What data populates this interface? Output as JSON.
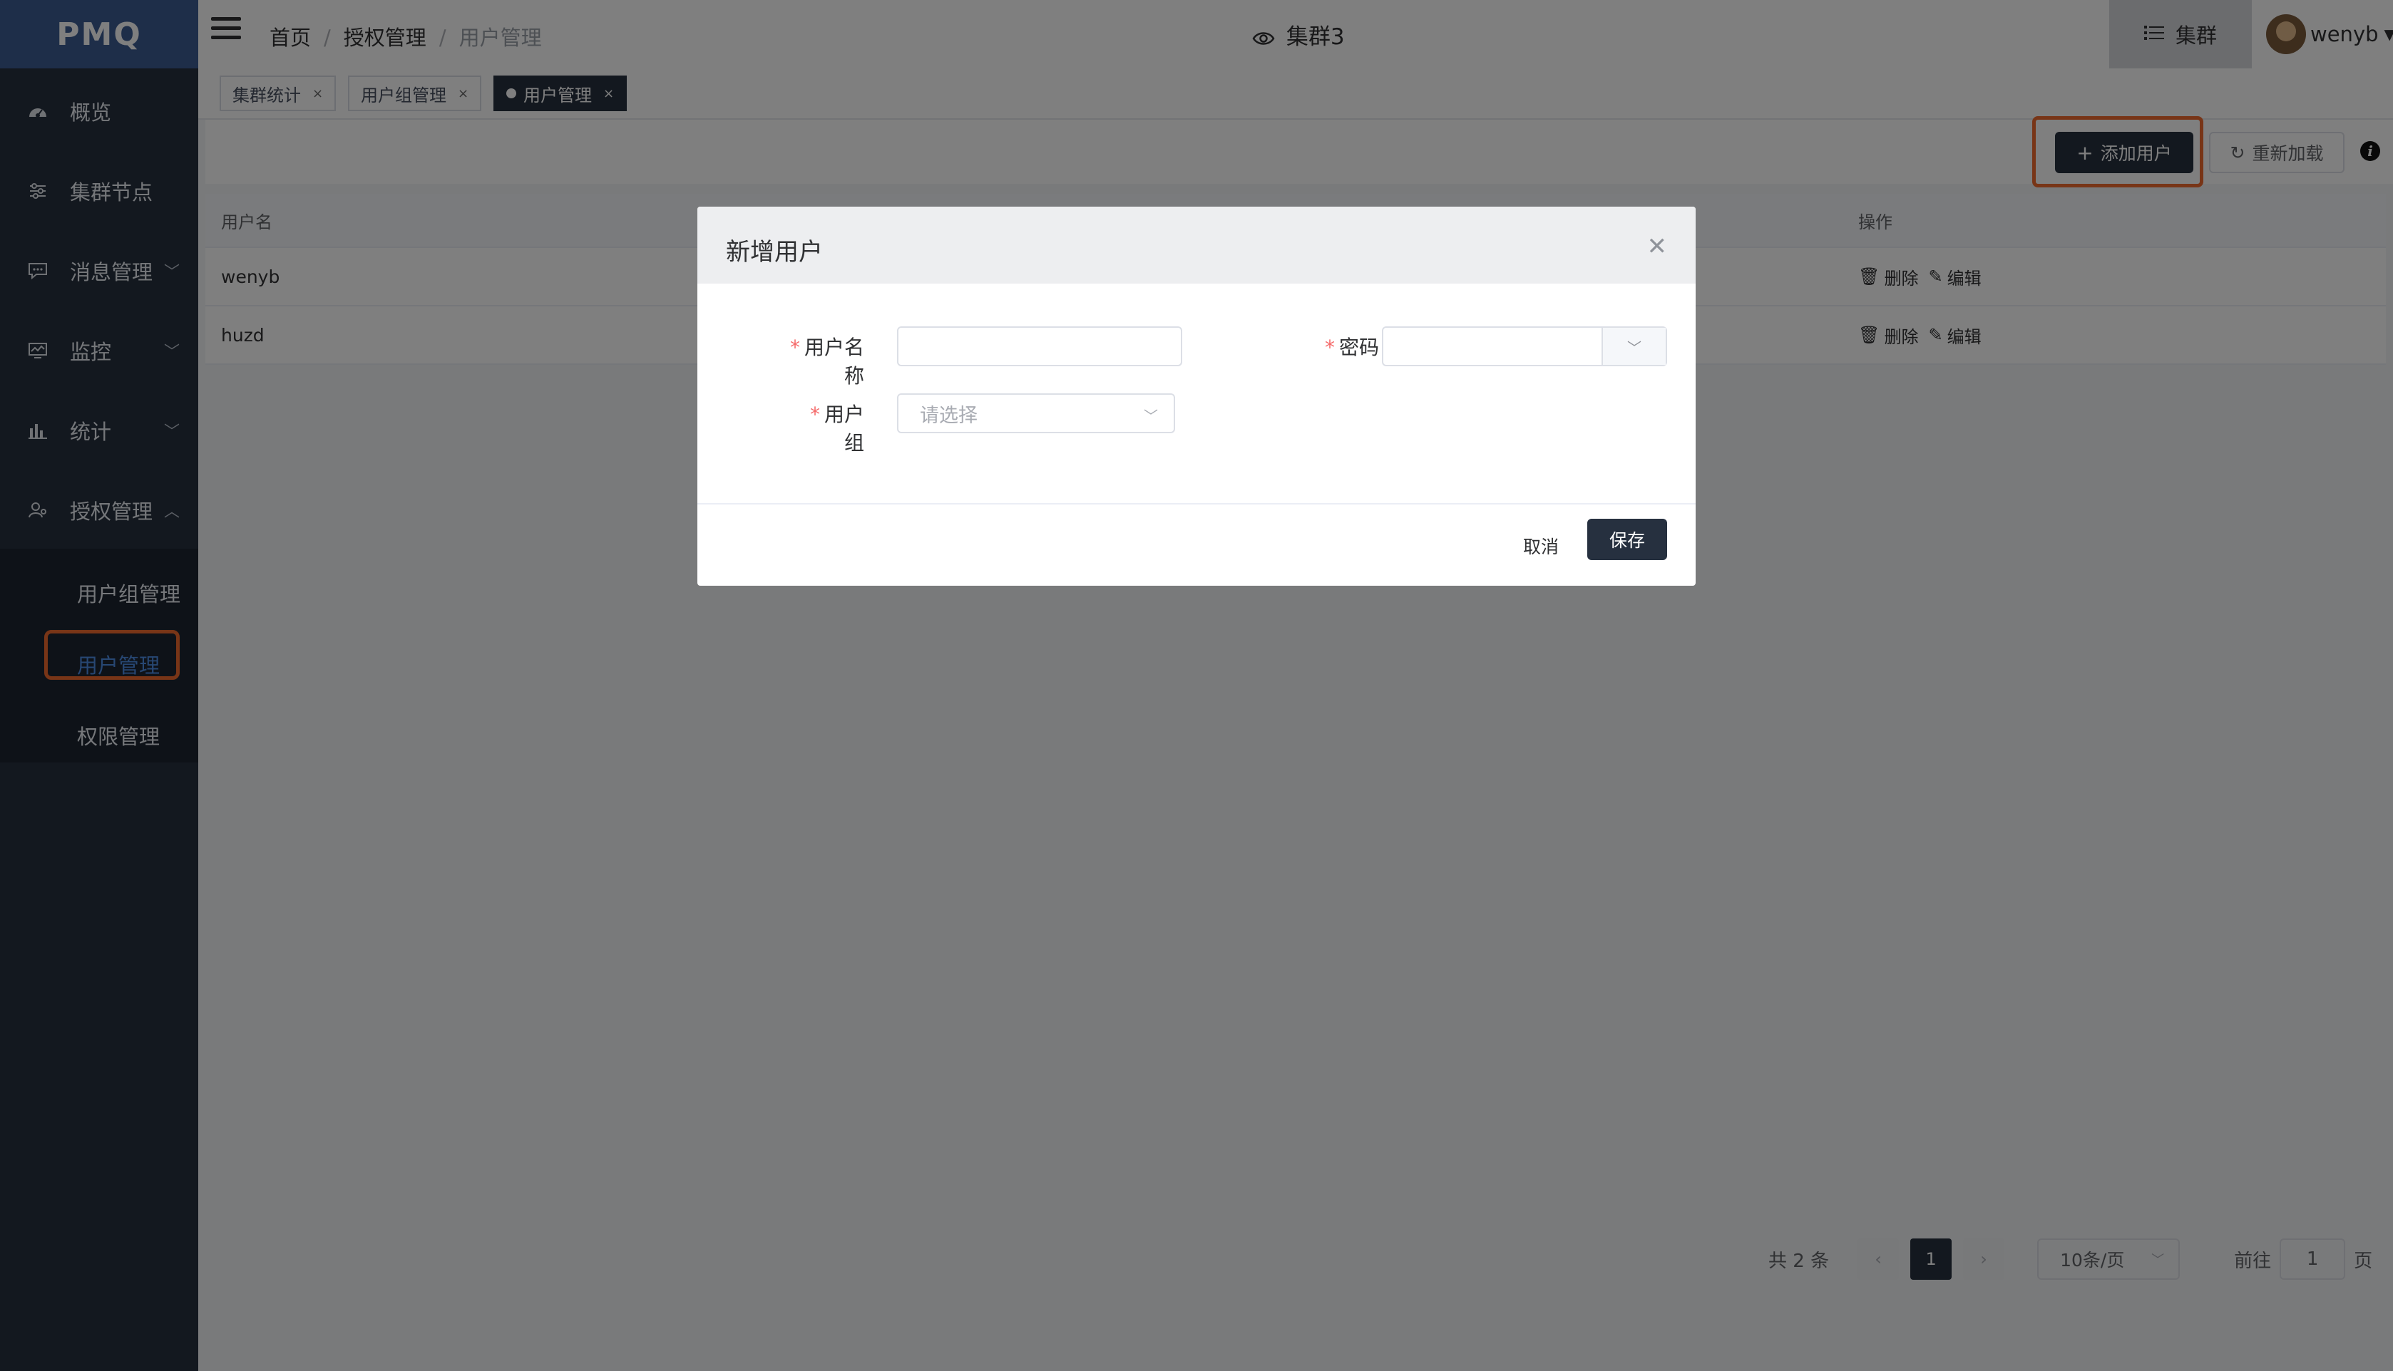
{
  "app": {
    "logo": "PMQ"
  },
  "sidebar": {
    "items": [
      {
        "label": "概览",
        "icon": "dashboard-icon"
      },
      {
        "label": "集群节点",
        "icon": "nodes-icon"
      },
      {
        "label": "消息管理",
        "icon": "message-icon"
      },
      {
        "label": "监控",
        "icon": "monitor-icon"
      },
      {
        "label": "统计",
        "icon": "bar-chart-icon"
      },
      {
        "label": "授权管理",
        "icon": "user-auth-icon"
      }
    ],
    "submenu": [
      {
        "label": "用户组管理"
      },
      {
        "label": "用户管理"
      },
      {
        "label": "权限管理"
      }
    ]
  },
  "header": {
    "breadcrumb": [
      "首页",
      "授权管理",
      "用户管理"
    ],
    "cluster_title": "集群3",
    "cluster_button": "集群",
    "username": "wenyb"
  },
  "tabs": [
    {
      "label": "集群统计"
    },
    {
      "label": "用户组管理"
    },
    {
      "label": "用户管理"
    }
  ],
  "toolbar": {
    "add_label": "添加用户",
    "reload_label": "重新加载"
  },
  "table": {
    "columns": [
      "用户名",
      "操作"
    ],
    "rows": [
      {
        "username": "wenyb"
      },
      {
        "username": "huzd"
      }
    ],
    "delete_label": "删除",
    "edit_label": "编辑"
  },
  "pagination": {
    "total": "共 2 条",
    "current_page": "1",
    "page_size": "10条/页",
    "goto_label": "前往",
    "goto_value": "1",
    "page_suffix": "页"
  },
  "dialog": {
    "title": "新增用户",
    "fields": {
      "username_label": "用户名称",
      "password_label": "密码",
      "group_label": "用户组",
      "group_placeholder": "请选择"
    },
    "cancel_label": "取消",
    "save_label": "保存"
  },
  "colors": {
    "sidebar_bg": "#26303f",
    "logo_bg": "#3d5d93",
    "primary_button": "#26303f",
    "highlight": "#f06a2e",
    "required": "#f56c6c",
    "active_submenu_text": "#4f8fe6"
  }
}
